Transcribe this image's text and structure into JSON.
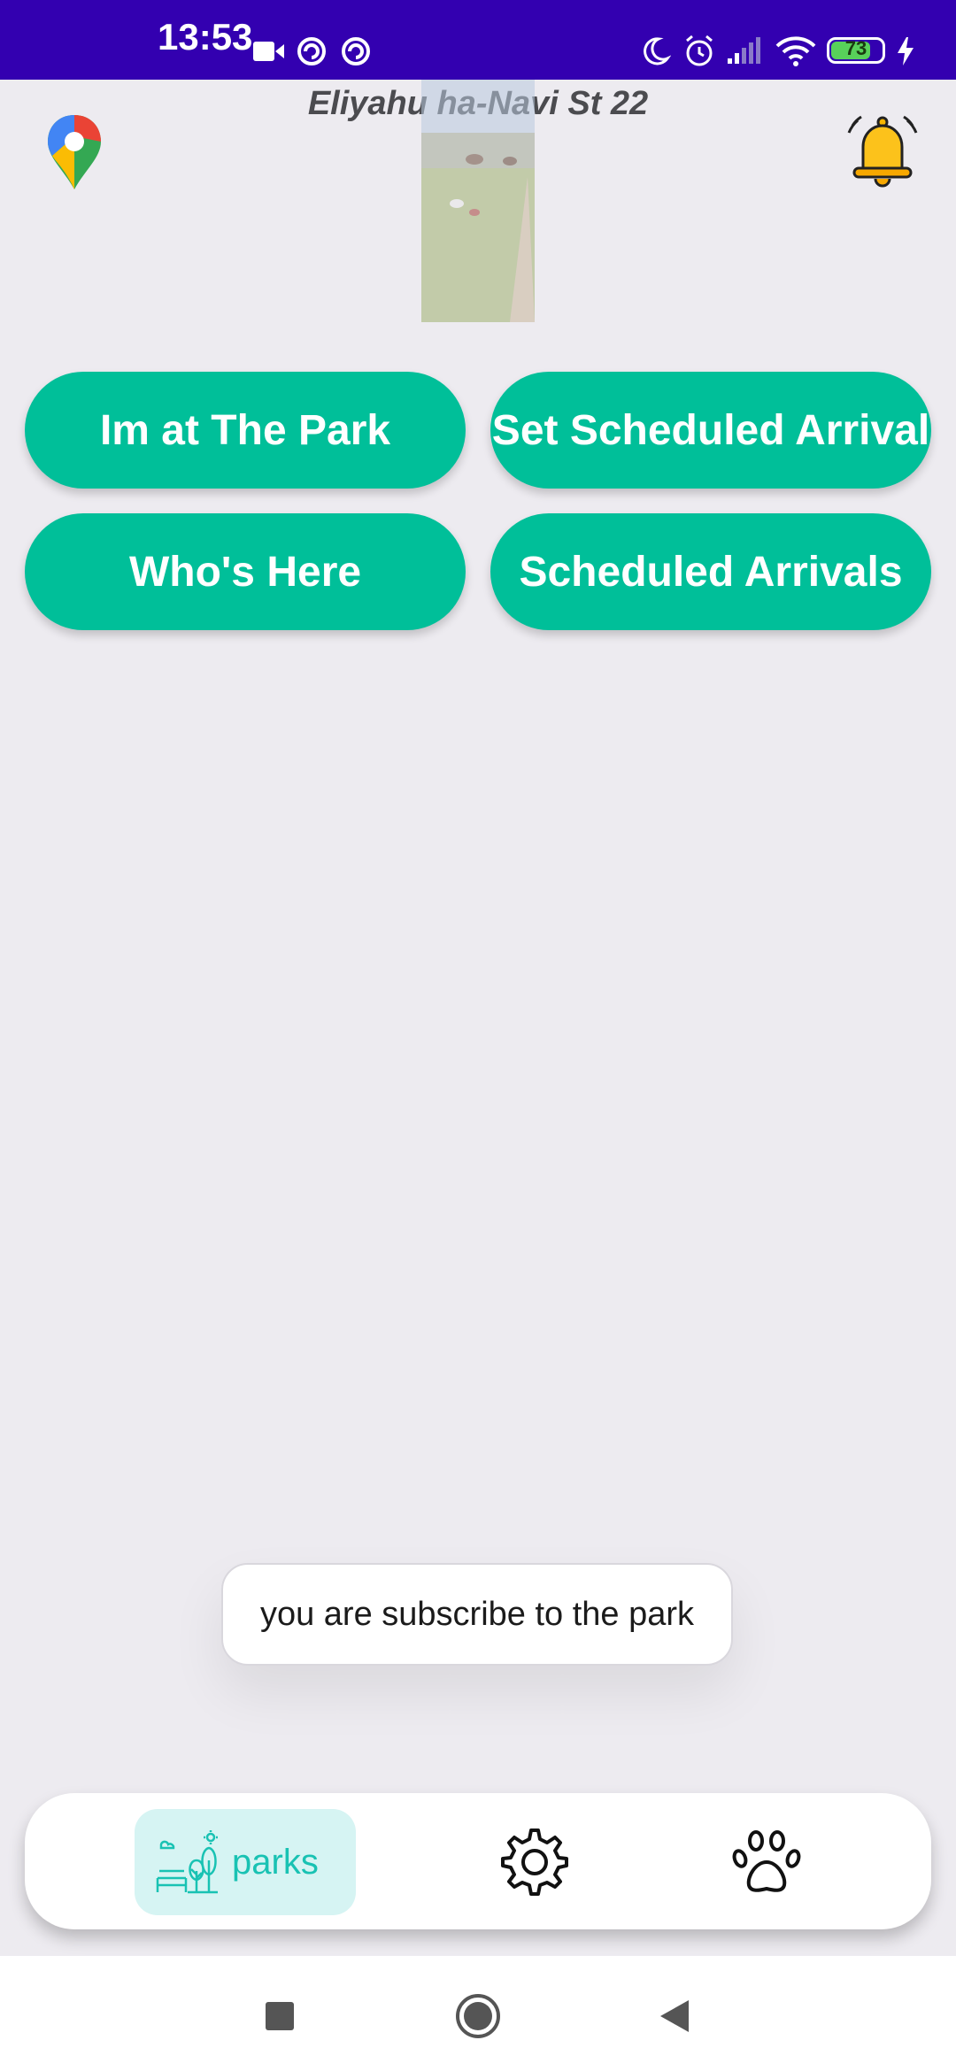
{
  "status_bar": {
    "time": "13:53",
    "battery_level": "73",
    "battery_fraction": 0.73
  },
  "header": {
    "address": "Eliyahu ha-Navi St 22",
    "maps_icon": "google-maps-pin-icon",
    "bell_icon": "bell-icon"
  },
  "actions": {
    "im_at_park": "Im at The Park",
    "set_scheduled_arrival": "Set Scheduled Arrival",
    "whos_here": "Who's Here",
    "scheduled_arrivals": "Scheduled Arrivals"
  },
  "toast": {
    "message": "you are subscribe to the park"
  },
  "bottom_nav": {
    "parks_label": "parks",
    "settings_icon": "gear-icon",
    "pets_icon": "paw-icon"
  },
  "colors": {
    "status_bar": "#3300b0",
    "accent": "#00bf99",
    "nav_active_bg": "#d6f4f3",
    "nav_active_text": "#19c2b3",
    "background": "#edebf0"
  }
}
